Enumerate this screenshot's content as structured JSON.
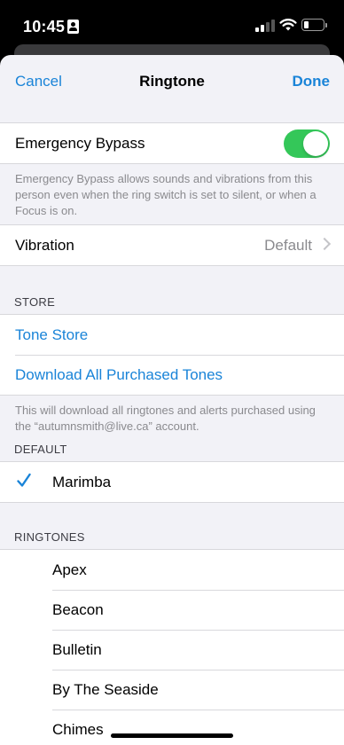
{
  "status_bar": {
    "time": "10:45"
  },
  "nav": {
    "cancel": "Cancel",
    "title": "Ringtone",
    "done": "Done"
  },
  "emergency_bypass": {
    "label": "Emergency Bypass",
    "enabled": true,
    "footer": "Emergency Bypass allows sounds and vibrations from this person even when the ring switch is set to silent, or when a Focus is on."
  },
  "vibration": {
    "label": "Vibration",
    "value": "Default"
  },
  "store": {
    "header": "STORE",
    "tone_store": "Tone Store",
    "download_all": "Download All Purchased Tones",
    "footer": "This will download all ringtones and alerts purchased using the “autumnsmith@live.ca” account."
  },
  "default_section": {
    "header": "DEFAULT",
    "selected": "Marimba"
  },
  "ringtones": {
    "header": "RINGTONES",
    "items": [
      "Apex",
      "Beacon",
      "Bulletin",
      "By The Seaside",
      "Chimes"
    ]
  },
  "colors": {
    "accent": "#1a84d8",
    "toggle_on": "#34c759"
  }
}
